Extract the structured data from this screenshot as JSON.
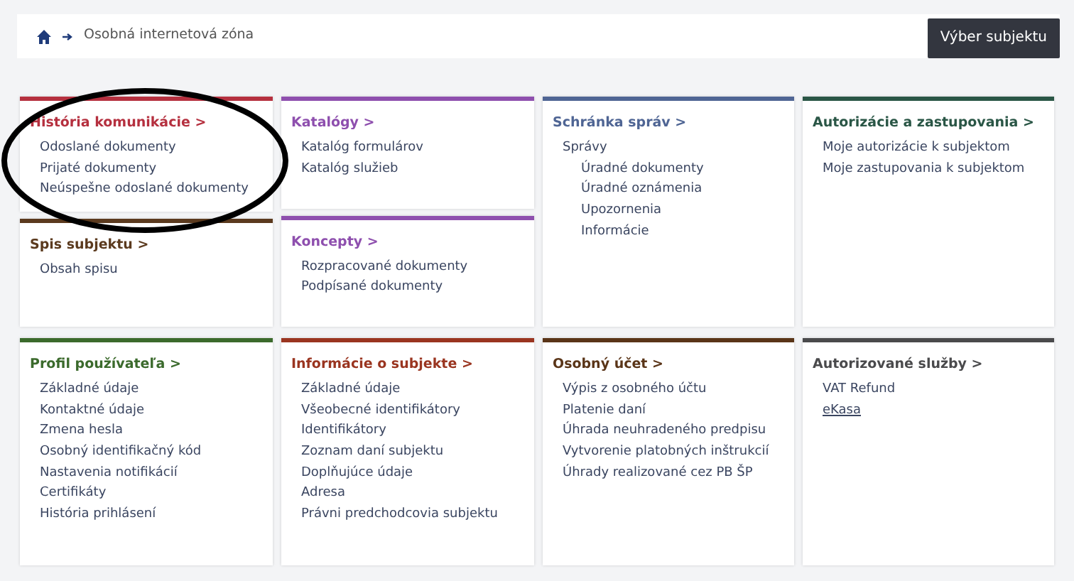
{
  "breadcrumb": {
    "items": [
      "Osobná internetová zóna"
    ]
  },
  "subject_button": "Výber subjektu",
  "rows": [
    {
      "columns": [
        [
          {
            "title": "História komunikácie >",
            "color": "#b5303f",
            "items": [
              {
                "label": "Odoslané dokumenty"
              },
              {
                "label": "Prijaté dokumenty"
              },
              {
                "label": "Neúspešne odoslané dokumenty"
              }
            ]
          },
          {
            "title": "Spis subjektu >",
            "color": "#5b3a1e",
            "items": [
              {
                "label": "Obsah spisu"
              }
            ]
          }
        ],
        [
          {
            "title": "Katalógy >",
            "color": "#8e4fae",
            "items": [
              {
                "label": "Katalóg formulárov"
              },
              {
                "label": "Katalóg služieb"
              }
            ]
          },
          {
            "title": "Koncepty >",
            "color": "#8e4fae",
            "items": [
              {
                "label": "Rozpracované dokumenty"
              },
              {
                "label": "Podpísané dokumenty"
              }
            ]
          }
        ],
        [
          {
            "title": "Schránka správ >",
            "color": "#4f6594",
            "items": [
              {
                "label": "Správy",
                "children": [
                  {
                    "label": "Úradné dokumenty"
                  },
                  {
                    "label": "Úradné oznámenia"
                  },
                  {
                    "label": "Upozornenia"
                  },
                  {
                    "label": "Informácie"
                  }
                ]
              }
            ]
          }
        ],
        [
          {
            "title": "Autorizácie a zastupovania >",
            "color": "#2a5646",
            "items": [
              {
                "label": "Moje autorizácie k subjektom"
              },
              {
                "label": "Moje zastupovania k subjektom"
              }
            ]
          }
        ]
      ]
    },
    {
      "columns": [
        [
          {
            "title": "Profil používateľa >",
            "color": "#3b6a2c",
            "items": [
              {
                "label": "Základné údaje"
              },
              {
                "label": "Kontaktné údaje"
              },
              {
                "label": "Zmena hesla"
              },
              {
                "label": "Osobný identifikačný kód"
              },
              {
                "label": "Nastavenia notifikácií"
              },
              {
                "label": "Certifikáty"
              },
              {
                "label": "História prihlásení"
              }
            ]
          }
        ],
        [
          {
            "title": "Informácie o subjekte >",
            "color": "#9a3520",
            "items": [
              {
                "label": "Základné údaje"
              },
              {
                "label": "Všeobecné identifikátory"
              },
              {
                "label": "Identifikátory"
              },
              {
                "label": "Zoznam daní subjektu"
              },
              {
                "label": "Doplňujúce údaje"
              },
              {
                "label": "Adresa"
              },
              {
                "label": "Právni predchodcovia subjektu"
              }
            ]
          }
        ],
        [
          {
            "title": "Osobný účet >",
            "color": "#5a3518",
            "items": [
              {
                "label": "Výpis z osobného účtu"
              },
              {
                "label": "Platenie daní"
              },
              {
                "label": "Úhrada neuhradeného predpisu"
              },
              {
                "label": "Vytvorenie platobných inštrukcií"
              },
              {
                "label": "Úhrady realizované cez PB ŠP"
              }
            ]
          }
        ],
        [
          {
            "title": "Autorizované služby >",
            "color": "#4a4a4c",
            "items": [
              {
                "label": "VAT Refund",
                "underlined": false
              },
              {
                "label": "eKasa",
                "underlined": true
              }
            ]
          }
        ]
      ]
    }
  ]
}
